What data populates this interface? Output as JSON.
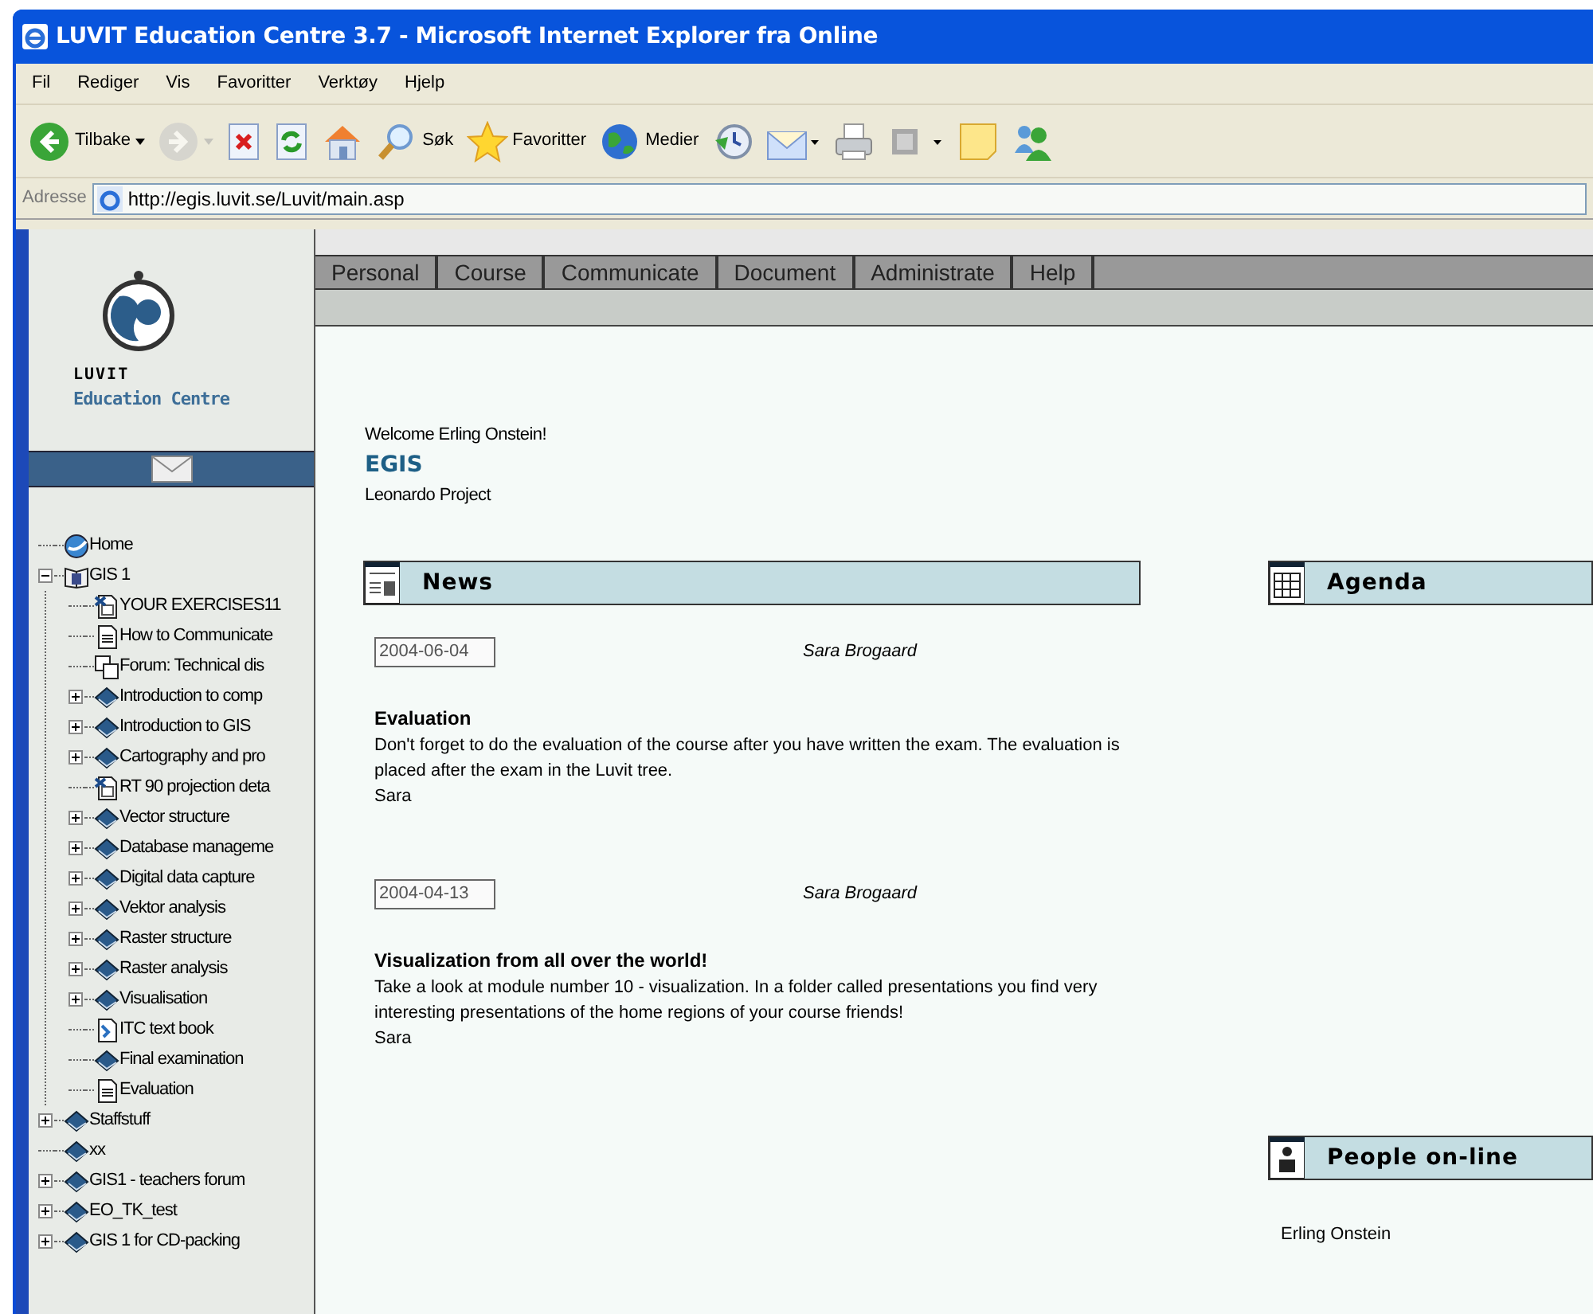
{
  "window": {
    "title": "LUVIT Education Centre 3.7 - Microsoft Internet Explorer fra Online"
  },
  "menu": [
    "Fil",
    "Rediger",
    "Vis",
    "Favoritter",
    "Verktøy",
    "Hjelp"
  ],
  "toolbar": [
    {
      "kind": "back",
      "label": "Tilbake",
      "disabled": false
    },
    {
      "kind": "forward",
      "disabled": true
    },
    {
      "kind": "stop"
    },
    {
      "kind": "refresh"
    },
    {
      "kind": "home"
    },
    {
      "kind": "search",
      "label": "Søk"
    },
    {
      "kind": "favorites",
      "label": "Favoritter"
    },
    {
      "kind": "media",
      "label": "Medier"
    },
    {
      "kind": "history"
    },
    {
      "kind": "mail"
    },
    {
      "kind": "print"
    },
    {
      "kind": "fullscreen"
    },
    {
      "kind": "note"
    },
    {
      "kind": "messenger"
    }
  ],
  "address": {
    "label": "Adresse",
    "value": "http://egis.luvit.se/Luvit/main.asp"
  },
  "logo": {
    "name": "LUVIT",
    "subtitle": "Education Centre"
  },
  "tree": [
    {
      "label": "Home",
      "kind": "globe",
      "expandable": false
    },
    {
      "label": "GIS 1",
      "kind": "course",
      "expandable": true,
      "expanded": true,
      "children": [
        {
          "label": "YOUR EXERCISES11",
          "kind": "exercise",
          "expandable": false
        },
        {
          "label": "How to Communicate",
          "kind": "document",
          "expandable": false
        },
        {
          "label": "Forum: Technical dis",
          "kind": "forum",
          "expandable": false
        },
        {
          "label": "Introduction to comp",
          "kind": "book",
          "expandable": true,
          "expanded": false
        },
        {
          "label": "Introduction to GIS",
          "kind": "book",
          "expandable": true,
          "expanded": false
        },
        {
          "label": "Cartography and pro",
          "kind": "book",
          "expandable": true,
          "expanded": false
        },
        {
          "label": "RT 90 projection deta",
          "kind": "exercise",
          "expandable": false
        },
        {
          "label": "Vector structure",
          "kind": "book",
          "expandable": true,
          "expanded": false
        },
        {
          "label": "Database manageme",
          "kind": "book",
          "expandable": true,
          "expanded": false
        },
        {
          "label": "Digital data capture",
          "kind": "book",
          "expandable": true,
          "expanded": false
        },
        {
          "label": "Vektor analysis",
          "kind": "book",
          "expandable": true,
          "expanded": false
        },
        {
          "label": "Raster structure",
          "kind": "book",
          "expandable": true,
          "expanded": false
        },
        {
          "label": "Raster analysis",
          "kind": "book",
          "expandable": true,
          "expanded": false
        },
        {
          "label": "Visualisation",
          "kind": "book",
          "expandable": true,
          "expanded": false
        },
        {
          "label": "ITC text book",
          "kind": "file",
          "expandable": false
        },
        {
          "label": "Final examination",
          "kind": "book",
          "expandable": false
        },
        {
          "label": "Evaluation",
          "kind": "document",
          "expandable": false
        }
      ]
    },
    {
      "label": "Staffstuff",
      "kind": "book",
      "expandable": true,
      "expanded": false
    },
    {
      "label": "xx",
      "kind": "book",
      "expandable": false
    },
    {
      "label": "GIS1 - teachers forum",
      "kind": "book",
      "expandable": true,
      "expanded": false
    },
    {
      "label": "EO_TK_test",
      "kind": "book",
      "expandable": true,
      "expanded": false
    },
    {
      "label": "GIS 1 for CD-packing",
      "kind": "book",
      "expandable": true,
      "expanded": false
    }
  ],
  "tabs": [
    "Personal",
    "Course",
    "Communicate",
    "Document",
    "Administrate",
    "Help"
  ],
  "welcome": "Welcome Erling Onstein!",
  "course_title": "EGIS",
  "course_subtitle": "Leonardo Project",
  "news": {
    "title": "News",
    "items": [
      {
        "date": "2004-06-04",
        "author": "Sara Brogaard",
        "title": "Evaluation",
        "body": "Don't forget to do the evaluation of the course after you have written the exam. The evaluation is placed after the exam in the Luvit tree.",
        "signature": "Sara"
      },
      {
        "date": "2004-04-13",
        "author": "Sara Brogaard",
        "title": "Visualization from all over the world!",
        "body": "Take a look at module number 10 - visualization. In a folder called presentations you find very interesting presentations of the home regions of your course friends!",
        "signature": "Sara"
      }
    ]
  },
  "agenda": {
    "title": "Agenda"
  },
  "people_online": {
    "title": "People on-line",
    "people": [
      "Erling Onstein"
    ]
  }
}
